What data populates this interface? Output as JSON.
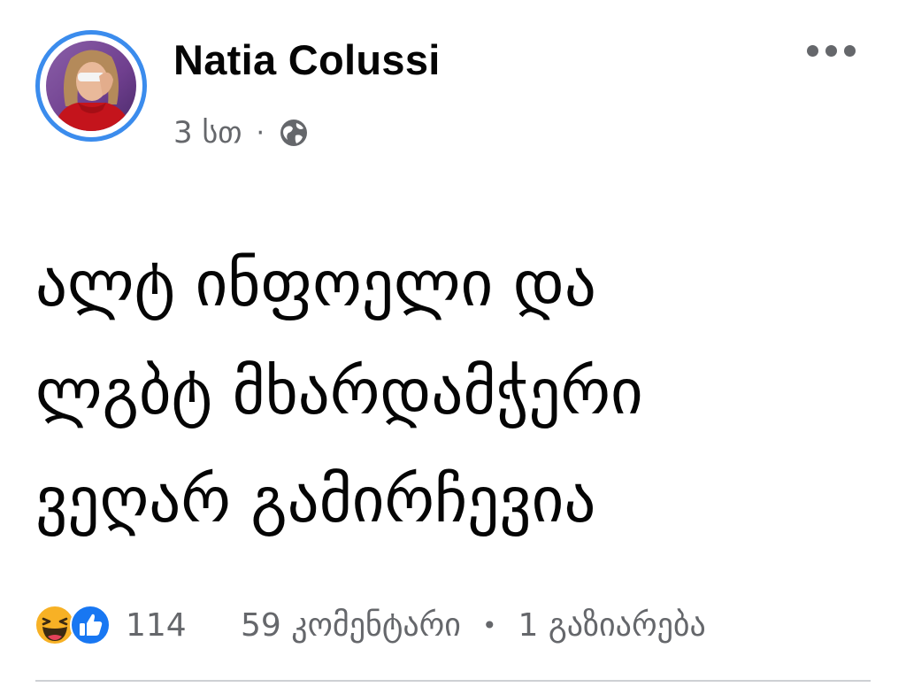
{
  "post": {
    "author": "Natia Colussi",
    "time": "3 სთ",
    "separator": "·",
    "privacy_icon": "globe-icon",
    "menu_icon": "more-horizontal-icon",
    "text_lines": [
      "ალტ ინფოელი და",
      "ლგბტ მხარდამჭერი",
      "ვეღარ გამირჩევია"
    ],
    "reactions": {
      "icons": [
        "haha-icon",
        "like-icon"
      ],
      "count": "114"
    },
    "comments": "59 კომენტარი",
    "dot": "•",
    "shares": "1 გაზიარება"
  },
  "colors": {
    "accent": "#3b8ced",
    "secondary_text": "#65676b",
    "like_blue": "#1877f2",
    "haha_yellow": "#f7b125"
  }
}
